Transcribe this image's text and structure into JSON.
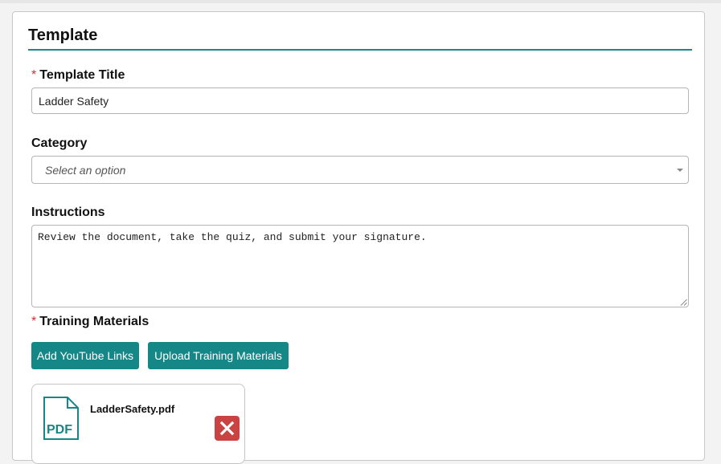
{
  "panel": {
    "title": "Template"
  },
  "template_title": {
    "required_mark": "*",
    "label": "Template Title",
    "value": "Ladder Safety"
  },
  "category": {
    "label": "Category",
    "placeholder": "Select an option"
  },
  "instructions": {
    "label": "Instructions",
    "value": "Review the document, take the quiz, and submit your signature."
  },
  "training_materials": {
    "required_mark": "*",
    "label": "Training Materials",
    "add_youtube_label": "Add YouTube Links",
    "upload_label": "Upload Training Materials",
    "files": [
      {
        "name": "LadderSafety.pdf",
        "type_label": "PDF",
        "icon": "pdf-file-icon"
      }
    ]
  },
  "colors": {
    "accent": "#168787",
    "danger": "#c94343",
    "required": "#d32f2f"
  }
}
